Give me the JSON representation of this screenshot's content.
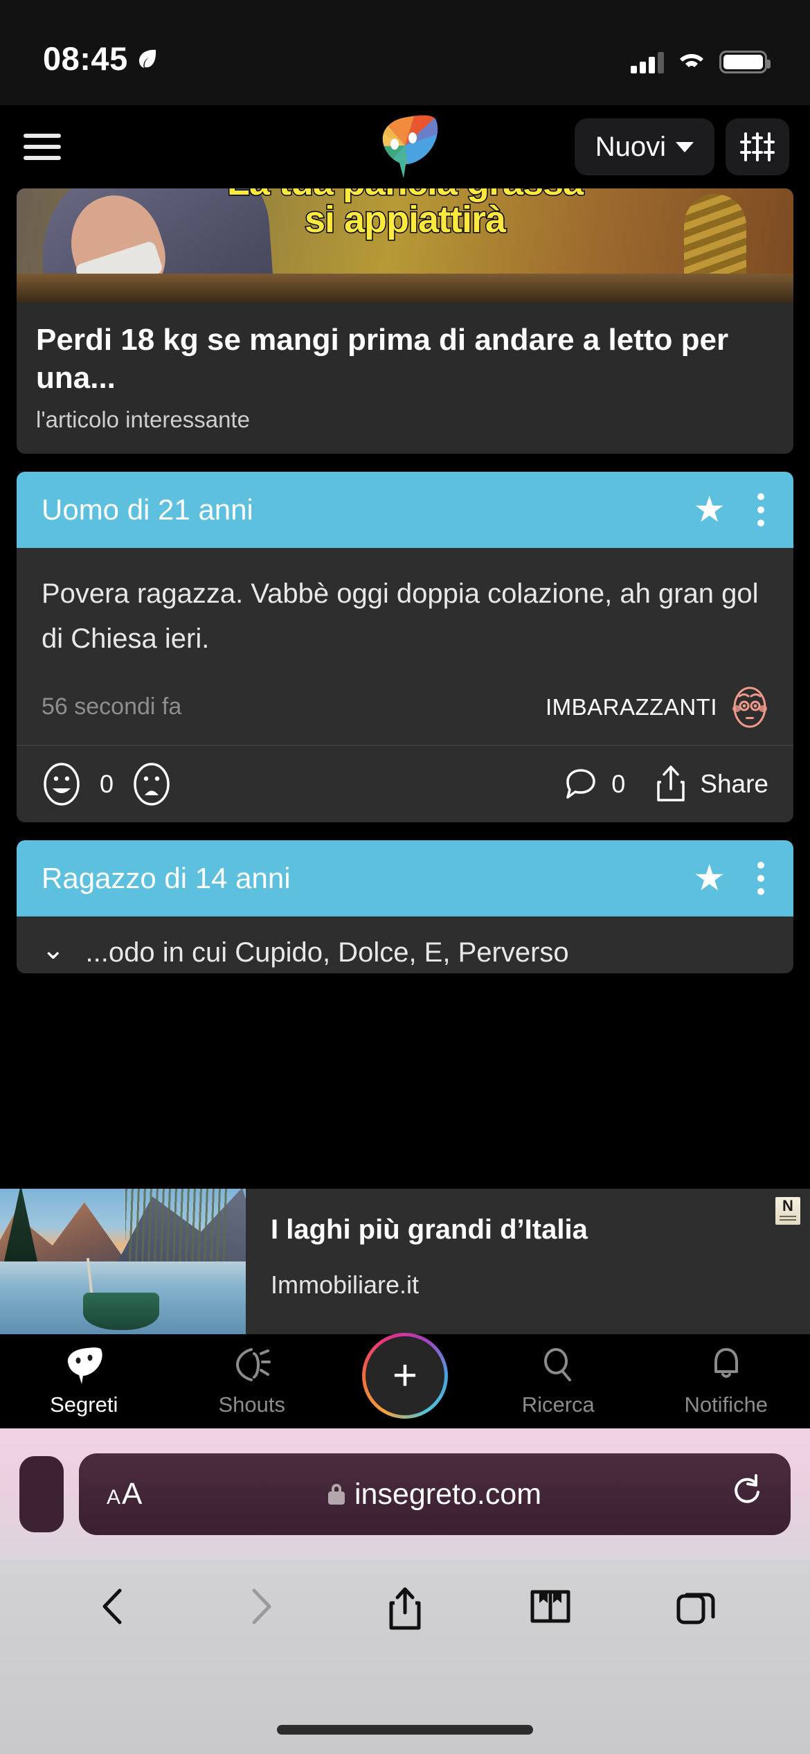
{
  "status_bar": {
    "time": "08:45",
    "location_icon": "leaf-location-icon",
    "signal_icon": "cellular-signal-icon",
    "wifi_icon": "wifi-icon",
    "battery_icon": "battery-icon"
  },
  "app_header": {
    "menu_icon": "hamburger-menu-icon",
    "logo_icon": "insegreto-mask-logo",
    "sort_button": {
      "label": "Nuovi",
      "chevron": "chevron-down-icon"
    },
    "filter_icon": "sliders-filter-icon"
  },
  "sponsored_ad_top": {
    "image_overlay_line1": "La tua pancia grassa",
    "image_overlay_line2": "si appiattirà",
    "title": "Perdi 18 kg se mangi prima di andare a letto per una...",
    "source": "l'articolo interessante"
  },
  "posts": [
    {
      "author": "Uomo di 21 anni",
      "star_icon": "star-icon",
      "menu_icon": "more-options-icon",
      "text": "Povera ragazza. Vabbè oggi doppia colazione, ah gran gol di Chiesa ieri.",
      "time": "56 secondi fa",
      "category": "IMBARAZZANTI",
      "category_emoji": "embarrassed-face-emoji",
      "actions": {
        "like_icon": "smiling-face-icon",
        "like_count": "0",
        "dislike_icon": "frowning-face-icon",
        "comment_icon": "comment-bubble-icon",
        "comment_count": "0",
        "share_icon": "share-icon",
        "share_label": "Share"
      }
    },
    {
      "author": "Ragazzo di 14 anni",
      "star_icon": "star-icon",
      "menu_icon": "more-options-icon",
      "expand_icon": "chevron-down-icon",
      "text": "...odo in cui Cupido, Dolce, E, Perverso"
    }
  ],
  "bottom_banner_ad": {
    "title": "I laghi più grandi d’Italia",
    "source": "Immobiliare.it",
    "image_alt": "lake-landscape-photo",
    "adchoices_badge": "N"
  },
  "tab_bar": {
    "items": [
      {
        "label": "Segreti",
        "icon": "mask-icon",
        "active": true
      },
      {
        "label": "Shouts",
        "icon": "shouts-icon",
        "active": false
      },
      {
        "label": "Ricerca",
        "icon": "search-icon",
        "active": false
      },
      {
        "label": "Notifiche",
        "icon": "bell-icon",
        "active": false
      }
    ],
    "compose": {
      "icon": "plus-icon",
      "label": "+"
    }
  },
  "browser": {
    "text_size_button": {
      "small_a": "A",
      "big_a": "A"
    },
    "lock_icon": "lock-icon",
    "url": "insegreto.com",
    "reload_icon": "reload-icon",
    "toolbar": {
      "back_icon": "back-chevron-icon",
      "forward_icon": "forward-chevron-icon",
      "share_icon": "share-icon",
      "bookmarks_icon": "book-bookmarks-icon",
      "tabs_icon": "tabs-icon"
    }
  },
  "colors": {
    "card_header_blue": "#5CC0DE",
    "card_body": "#2e2e2e",
    "page_bg": "#000000",
    "ad_yellow": "#fbe93f"
  }
}
